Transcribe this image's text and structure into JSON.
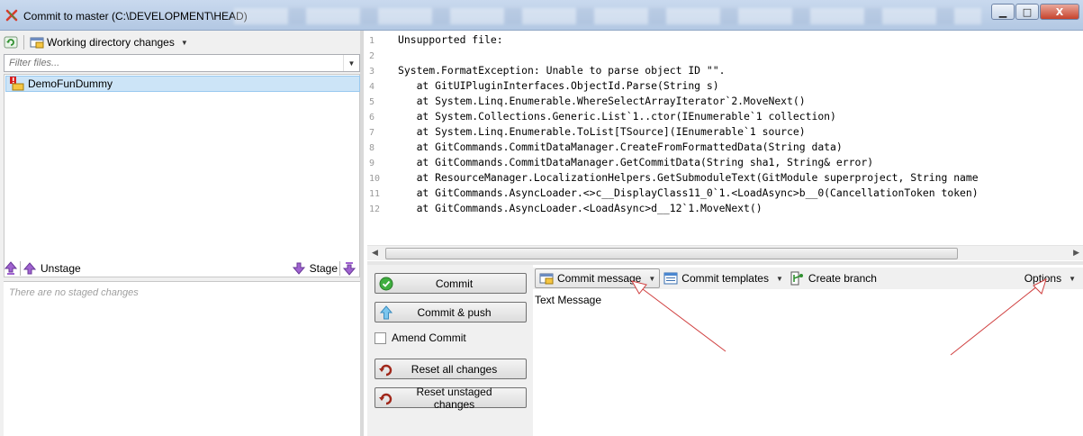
{
  "window": {
    "title": "Commit to master (C:\\DEVELOPMENT\\HEAD)",
    "minimize": "▁",
    "maximize": "□",
    "close": "X"
  },
  "unstaged": {
    "dropdown_label": "Working directory changes",
    "filter_placeholder": "Filter files...",
    "files": [
      {
        "name": "DemoFunDummy"
      }
    ]
  },
  "staging": {
    "unstage_label": "Unstage",
    "stage_label": "Stage",
    "empty_text": "There are no staged changes"
  },
  "diff": {
    "lines": [
      {
        "n": "1",
        "text": "Unsupported file:"
      },
      {
        "n": "2",
        "text": ""
      },
      {
        "n": "3",
        "text": "System.FormatException: Unable to parse object ID \"\"."
      },
      {
        "n": "4",
        "text": "   at GitUIPluginInterfaces.ObjectId.Parse(String s)"
      },
      {
        "n": "5",
        "text": "   at System.Linq.Enumerable.WhereSelectArrayIterator`2.MoveNext()"
      },
      {
        "n": "6",
        "text": "   at System.Collections.Generic.List`1..ctor(IEnumerable`1 collection)"
      },
      {
        "n": "7",
        "text": "   at System.Linq.Enumerable.ToList[TSource](IEnumerable`1 source)"
      },
      {
        "n": "8",
        "text": "   at GitCommands.CommitDataManager.CreateFromFormattedData(String data)"
      },
      {
        "n": "9",
        "text": "   at GitCommands.CommitDataManager.GetCommitData(String sha1, String& error)"
      },
      {
        "n": "10",
        "text": "   at ResourceManager.LocalizationHelpers.GetSubmoduleText(GitModule superproject, String name"
      },
      {
        "n": "11",
        "text": "   at GitCommands.AsyncLoader.<>c__DisplayClass11_0`1.<LoadAsync>b__0(CancellationToken token)"
      },
      {
        "n": "12",
        "text": "   at GitCommands.AsyncLoader.<LoadAsync>d__12`1.MoveNext()"
      }
    ]
  },
  "actions": {
    "commit": "Commit",
    "commit_push": "Commit & push",
    "amend": "Amend Commit",
    "reset_all": "Reset all changes",
    "reset_unstaged": "Reset unstaged changes"
  },
  "message_toolbar": {
    "commit_message": "Commit message",
    "commit_templates": "Commit templates",
    "create_branch": "Create branch",
    "options": "Options"
  },
  "commit_message_text": "Text Message",
  "colors": {
    "selection": "#cce4f7",
    "annotation_arrow": "#d04040"
  }
}
